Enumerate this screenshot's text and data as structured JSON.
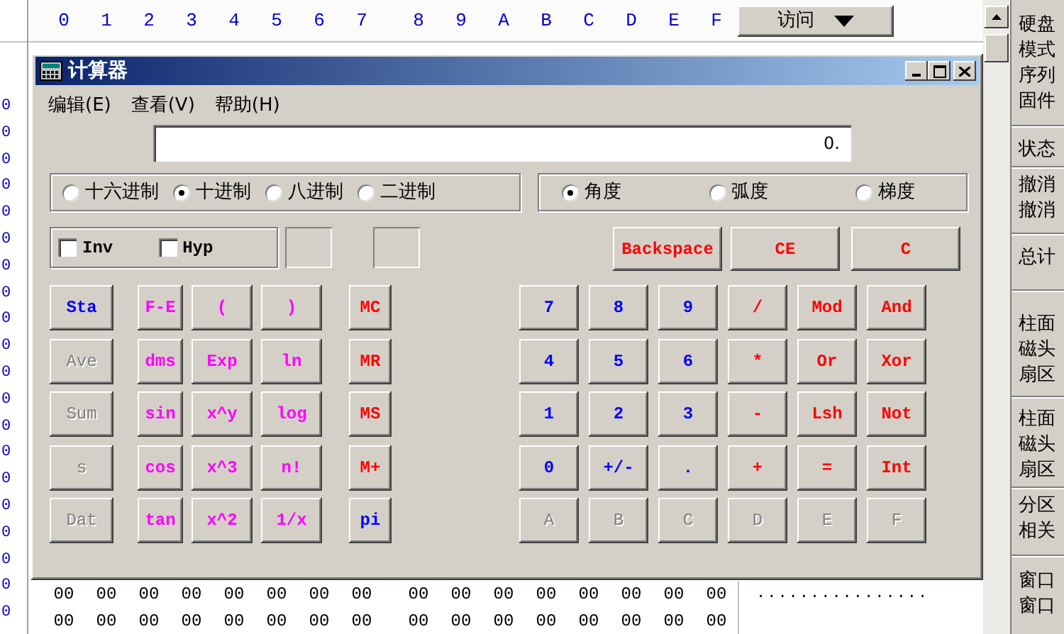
{
  "header": {
    "hex_digits": [
      "0",
      "1",
      "2",
      "3",
      "4",
      "5",
      "6",
      "7",
      "8",
      "9",
      "A",
      "B",
      "C",
      "D",
      "E",
      "F"
    ],
    "access_button": {
      "label": "访问"
    }
  },
  "offset_column": [
    "0",
    "0",
    "0",
    "0",
    "0",
    "0",
    "0",
    "0",
    "0",
    "0",
    "0",
    "0",
    "0",
    "0",
    "0",
    "0",
    "0",
    "0",
    "0",
    "0"
  ],
  "hex_rows": [
    [
      "00",
      "00",
      "00",
      "00",
      "00",
      "00",
      "00",
      "00",
      "00",
      "00",
      "00",
      "00",
      "00",
      "00",
      "00",
      "00"
    ],
    [
      "00",
      "00",
      "00",
      "00",
      "00",
      "00",
      "00",
      "00",
      "00",
      "00",
      "00",
      "00",
      "00",
      "00",
      "00",
      "00"
    ]
  ],
  "ascii_rows": [
    "................"
  ],
  "side_panel": {
    "groups": [
      [
        "硬盘",
        "模式",
        "序列",
        "固件"
      ],
      [
        "状态"
      ],
      [
        "撤消",
        "撤消"
      ],
      [
        "总计"
      ],
      [
        "柱面",
        "磁头",
        "扇区"
      ],
      [
        "柱面",
        "磁头",
        "扇区"
      ],
      [
        "分区",
        "相关"
      ],
      [
        "窗口",
        "窗口"
      ]
    ]
  },
  "calculator": {
    "title": "计算器",
    "menu": [
      "编辑(E)",
      "查看(V)",
      "帮助(H)"
    ],
    "display": "0.",
    "number_systems": [
      {
        "label": "十六进制",
        "selected": false
      },
      {
        "label": "十进制",
        "selected": true
      },
      {
        "label": "八进制",
        "selected": false
      },
      {
        "label": "二进制",
        "selected": false
      }
    ],
    "angle_units": [
      {
        "label": "角度",
        "selected": true
      },
      {
        "label": "弧度",
        "selected": false
      },
      {
        "label": "梯度",
        "selected": false
      }
    ],
    "checkboxes": [
      {
        "label": "Inv",
        "checked": false
      },
      {
        "label": "Hyp",
        "checked": false
      }
    ],
    "edit_keys": [
      {
        "label": "Backspace",
        "color": "#ff0000",
        "disabled": false
      },
      {
        "label": "CE",
        "color": "#ff0000",
        "disabled": false
      },
      {
        "label": "C",
        "color": "#ff0000",
        "disabled": false
      }
    ],
    "left_keys": [
      [
        {
          "label": "Sta",
          "color": "#0000ff",
          "disabled": false
        },
        {
          "label": "F-E",
          "color": "#ff00ff",
          "disabled": false
        },
        {
          "label": "(",
          "color": "#ff00ff",
          "disabled": false
        },
        {
          "label": ")",
          "color": "#ff00ff",
          "disabled": false
        },
        {
          "label": "MC",
          "color": "#ff0000",
          "disabled": false
        }
      ],
      [
        {
          "label": "Ave",
          "disabled": true
        },
        {
          "label": "dms",
          "color": "#ff00ff",
          "disabled": false
        },
        {
          "label": "Exp",
          "color": "#ff00ff",
          "disabled": false
        },
        {
          "label": "ln",
          "color": "#ff00ff",
          "disabled": false
        },
        {
          "label": "MR",
          "color": "#ff0000",
          "disabled": false
        }
      ],
      [
        {
          "label": "Sum",
          "disabled": true
        },
        {
          "label": "sin",
          "color": "#ff00ff",
          "disabled": false
        },
        {
          "label": "x^y",
          "color": "#ff00ff",
          "disabled": false
        },
        {
          "label": "log",
          "color": "#ff00ff",
          "disabled": false
        },
        {
          "label": "MS",
          "color": "#ff0000",
          "disabled": false
        }
      ],
      [
        {
          "label": "s",
          "disabled": true
        },
        {
          "label": "cos",
          "color": "#ff00ff",
          "disabled": false
        },
        {
          "label": "x^3",
          "color": "#ff00ff",
          "disabled": false
        },
        {
          "label": "n!",
          "color": "#ff00ff",
          "disabled": false
        },
        {
          "label": "M+",
          "color": "#ff0000",
          "disabled": false
        }
      ],
      [
        {
          "label": "Dat",
          "disabled": true
        },
        {
          "label": "tan",
          "color": "#ff00ff",
          "disabled": false
        },
        {
          "label": "x^2",
          "color": "#ff00ff",
          "disabled": false
        },
        {
          "label": "1/x",
          "color": "#ff00ff",
          "disabled": false
        },
        {
          "label": "pi",
          "color": "#0000ff",
          "disabled": false
        }
      ]
    ],
    "right_keys": [
      [
        {
          "label": "7",
          "color": "#0000ff",
          "disabled": false
        },
        {
          "label": "8",
          "color": "#0000ff",
          "disabled": false
        },
        {
          "label": "9",
          "color": "#0000ff",
          "disabled": false
        },
        {
          "label": "/",
          "color": "#ff0000",
          "disabled": false
        },
        {
          "label": "Mod",
          "color": "#ff0000",
          "disabled": false
        },
        {
          "label": "And",
          "color": "#ff0000",
          "disabled": false
        }
      ],
      [
        {
          "label": "4",
          "color": "#0000ff",
          "disabled": false
        },
        {
          "label": "5",
          "color": "#0000ff",
          "disabled": false
        },
        {
          "label": "6",
          "color": "#0000ff",
          "disabled": false
        },
        {
          "label": "*",
          "color": "#ff0000",
          "disabled": false
        },
        {
          "label": "Or",
          "color": "#ff0000",
          "disabled": false
        },
        {
          "label": "Xor",
          "color": "#ff0000",
          "disabled": false
        }
      ],
      [
        {
          "label": "1",
          "color": "#0000ff",
          "disabled": false
        },
        {
          "label": "2",
          "color": "#0000ff",
          "disabled": false
        },
        {
          "label": "3",
          "color": "#0000ff",
          "disabled": false
        },
        {
          "label": "-",
          "color": "#ff0000",
          "disabled": false
        },
        {
          "label": "Lsh",
          "color": "#ff0000",
          "disabled": false
        },
        {
          "label": "Not",
          "color": "#ff0000",
          "disabled": false
        }
      ],
      [
        {
          "label": "0",
          "color": "#0000ff",
          "disabled": false
        },
        {
          "label": "+/-",
          "color": "#0000ff",
          "disabled": false
        },
        {
          "label": ".",
          "color": "#0000ff",
          "disabled": false
        },
        {
          "label": "+",
          "color": "#ff0000",
          "disabled": false
        },
        {
          "label": "=",
          "color": "#ff0000",
          "disabled": false
        },
        {
          "label": "Int",
          "color": "#ff0000",
          "disabled": false
        }
      ],
      [
        {
          "label": "A",
          "disabled": true
        },
        {
          "label": "B",
          "disabled": true
        },
        {
          "label": "C",
          "disabled": true
        },
        {
          "label": "D",
          "disabled": true
        },
        {
          "label": "E",
          "disabled": true
        },
        {
          "label": "F",
          "disabled": true
        }
      ]
    ]
  }
}
